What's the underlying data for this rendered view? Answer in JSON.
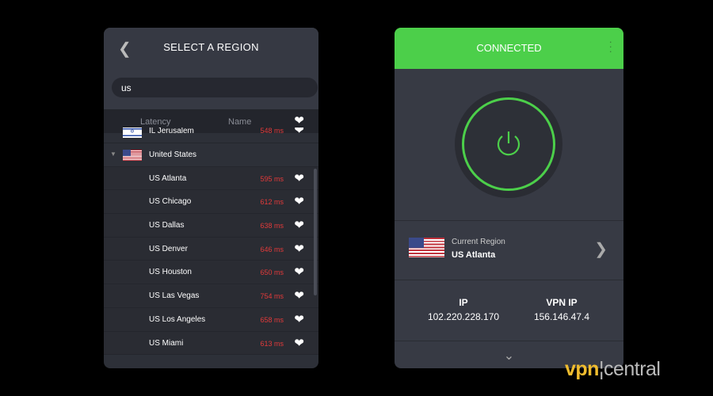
{
  "region_panel": {
    "title": "SELECT A REGION",
    "search_value": "us",
    "columns": {
      "latency": "Latency",
      "name": "Name"
    },
    "rows": [
      {
        "name": "IL Jerusalem",
        "ms": "548 ms",
        "flag": "israel"
      },
      {
        "name": "United States",
        "ms": "",
        "flag": "usa",
        "group": true
      },
      {
        "name": "US Atlanta",
        "ms": "595 ms"
      },
      {
        "name": "US Chicago",
        "ms": "612 ms"
      },
      {
        "name": "US Dallas",
        "ms": "638 ms"
      },
      {
        "name": "US Denver",
        "ms": "646 ms"
      },
      {
        "name": "US Houston",
        "ms": "650 ms"
      },
      {
        "name": "US Las Vegas",
        "ms": "754 ms"
      },
      {
        "name": "US Los Angeles",
        "ms": "658 ms"
      },
      {
        "name": "US Miami",
        "ms": "613 ms"
      }
    ]
  },
  "connection_panel": {
    "status": "CONNECTED",
    "accent": "#4ccf4a",
    "region_label": "Current Region",
    "region_value": "US Atlanta",
    "ip_label": "IP",
    "ip_value": "102.220.228.170",
    "vpn_ip_label": "VPN IP",
    "vpn_ip_value": "156.146.47.4"
  },
  "watermark": {
    "part1": "vpn",
    "part2": "central"
  }
}
